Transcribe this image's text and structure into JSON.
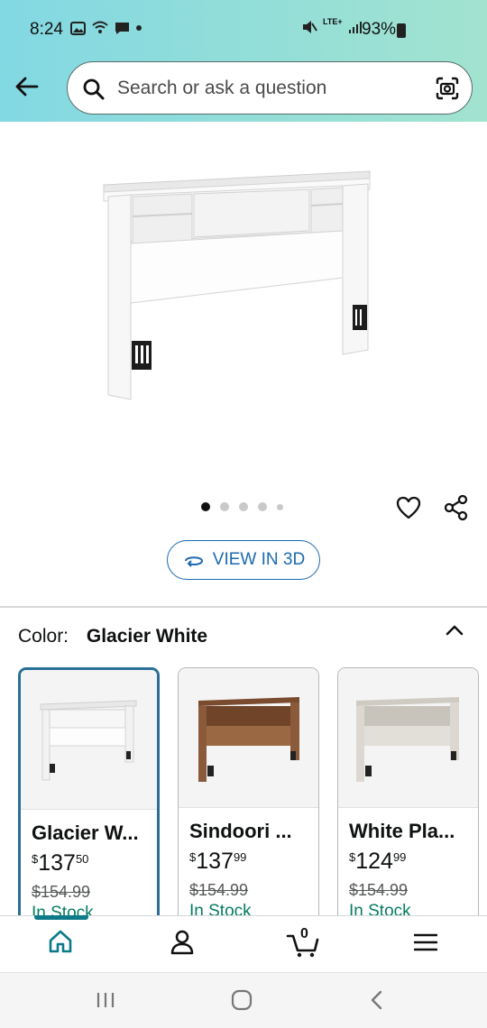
{
  "status_bar": {
    "time": "8:24",
    "battery": "93%",
    "network": "LTE+"
  },
  "header": {
    "search_placeholder": "Search or ask a question",
    "back_icon": "arrow-left-icon",
    "search_icon": "magnifier-icon",
    "camera_icon": "camera-scan-icon",
    "gradient_colors": [
      "#82d8e3",
      "#a2e3cf"
    ]
  },
  "gallery": {
    "image_count": 5,
    "active_index": 0,
    "view3d_label": "VIEW IN 3D"
  },
  "color_selector": {
    "label": "Color:",
    "selected": "Glacier White",
    "options": [
      {
        "name": "Glacier W...",
        "price_symbol": "$",
        "price_whole": "137",
        "price_fraction": "50",
        "list_price": "$154.99",
        "stock": "In Stock",
        "finish": "#f6f6f6"
      },
      {
        "name": "Sindoori ...",
        "price_symbol": "$",
        "price_whole": "137",
        "price_fraction": "99",
        "list_price": "$154.99",
        "stock": "In Stock",
        "finish": "#8a5a3a"
      },
      {
        "name": "White Pla...",
        "price_symbol": "$",
        "price_whole": "124",
        "price_fraction": "99",
        "list_price": "$154.99",
        "stock": "In Stock",
        "finish": "#d9d6d0"
      }
    ]
  },
  "bottom_nav": {
    "cart_count": "0",
    "items": [
      "home-icon",
      "account-icon",
      "cart-icon",
      "menu-icon"
    ]
  },
  "colors": {
    "accent_teal": "#0d7a8a",
    "link_blue": "#1c6ab0",
    "stock_green": "#067d62",
    "selected_border": "#2a6f96"
  }
}
